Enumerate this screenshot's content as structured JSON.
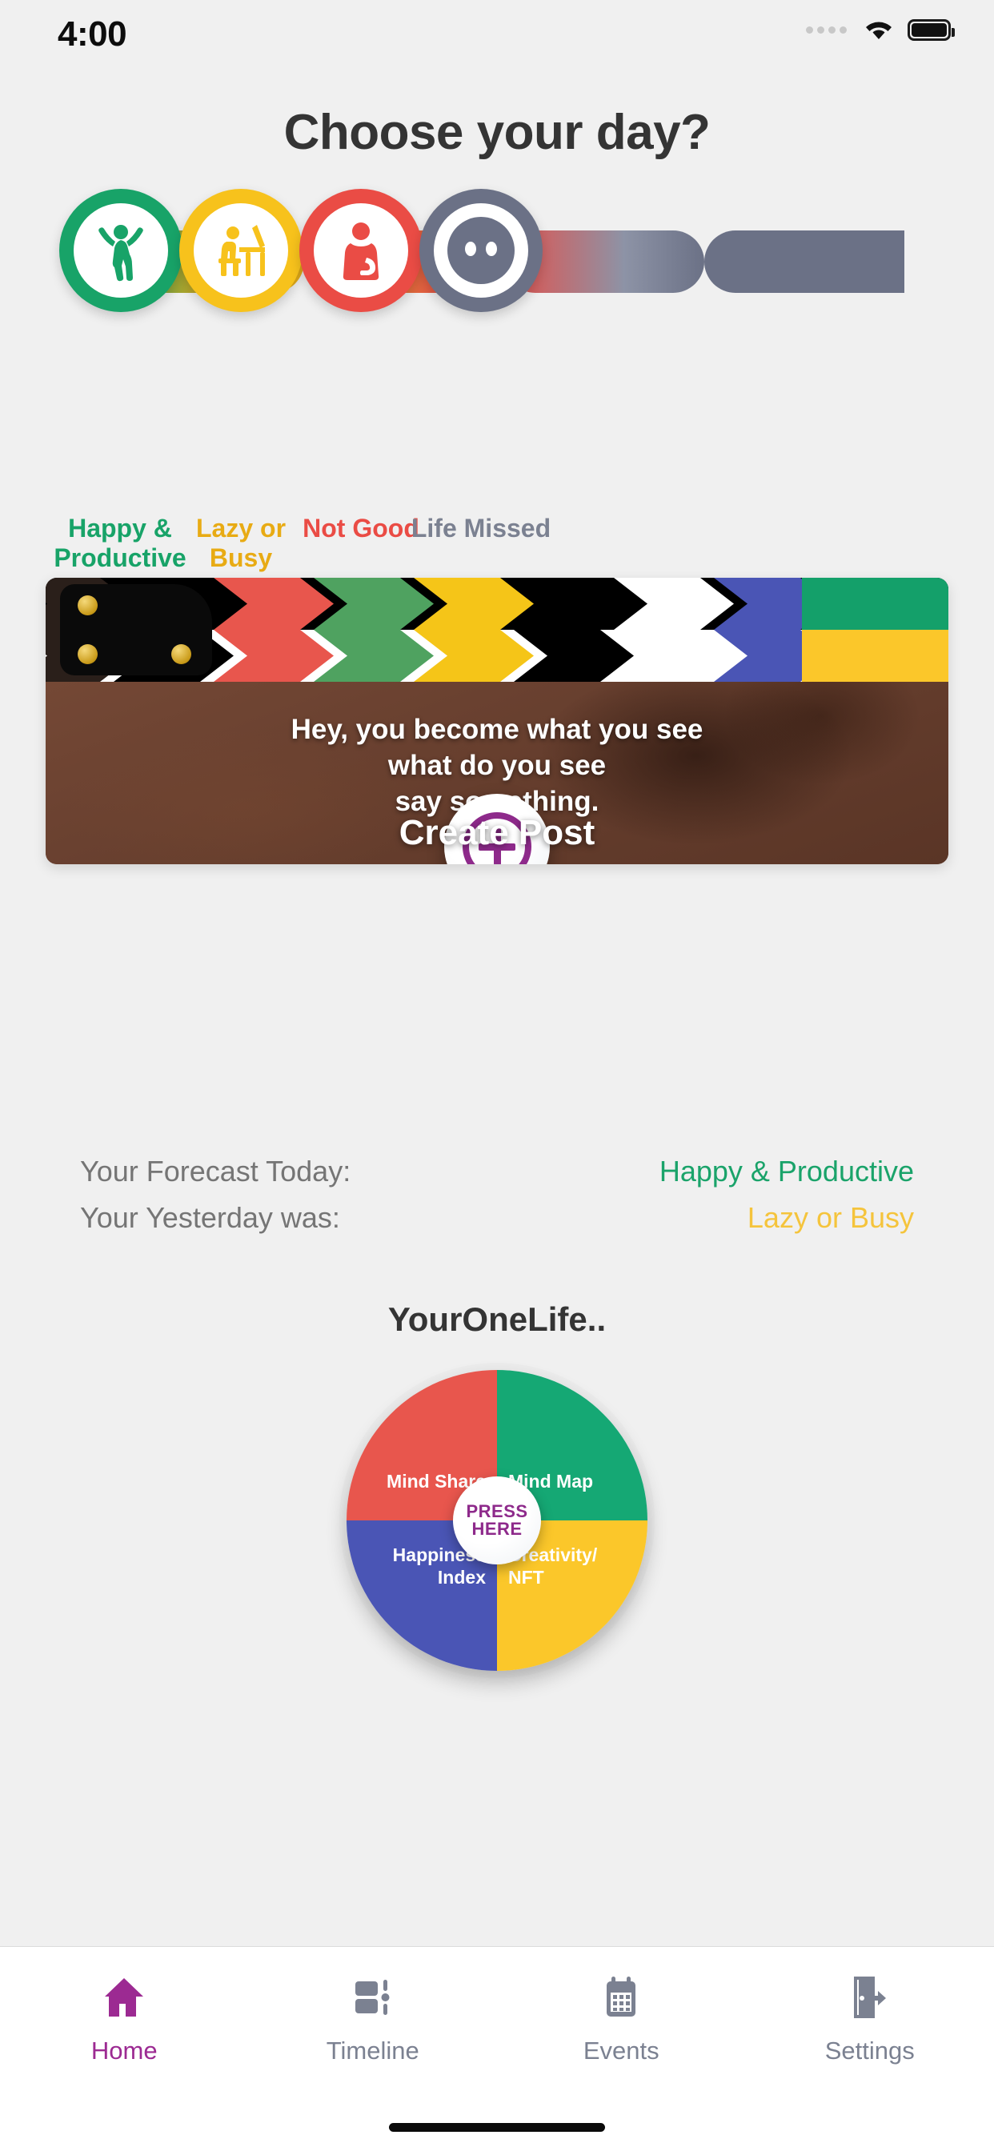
{
  "status_bar": {
    "time": "4:00",
    "wifi_icon": "wifi-icon",
    "battery_icon": "battery-icon",
    "signal_dots_icon": "signal-dots-icon"
  },
  "header": {
    "title": "Choose your day?"
  },
  "mood_selector": {
    "options": [
      {
        "label": "Happy &\nProductive",
        "color": "#18a368",
        "icon": "jumping-person-icon"
      },
      {
        "label": "Lazy or\nBusy",
        "color": "#f7c21c",
        "icon": "person-at-desk-icon"
      },
      {
        "label": "Not Good",
        "color": "#ea4c45",
        "icon": "sad-person-icon"
      },
      {
        "label": "Life Missed",
        "color": "#6b7186",
        "icon": "blank-face-icon"
      }
    ]
  },
  "post_card": {
    "prompt_line1": "Hey, you become what you see",
    "prompt_line2": "what do you see",
    "prompt_line3": "say something.",
    "create_label": "Create Post",
    "plus_icon": "plus-circle-icon",
    "clapper_icon": "clapper-board-icon",
    "clapper_colors": [
      "#2a1f1a",
      "#000000",
      "#e8564d",
      "#4fa260",
      "#f5c518",
      "#000000",
      "#ffffff",
      "#4a55b5",
      "#14a06a"
    ],
    "accent": "#8e2a8b"
  },
  "forecast": {
    "today_key": "Your Forecast Today:",
    "today_value": "Happy & Productive",
    "today_color": "#1aa36a",
    "yesterday_key": "Your Yesterday was:",
    "yesterday_value": "Lazy or Busy",
    "yesterday_color": "#f5c43c"
  },
  "wheel": {
    "title": "YourOneLife..",
    "center_line1": "PRESS",
    "center_line2": "HERE",
    "center_color": "#8e2a8b",
    "quadrants": [
      {
        "label": "Mind Share",
        "color": "#e8564d",
        "position": "top-left"
      },
      {
        "label": "Mind Map",
        "color": "#15a874",
        "position": "top-right"
      },
      {
        "label": "Happiness\nIndex",
        "color": "#4a55b5",
        "position": "bottom-left"
      },
      {
        "label": "Creativity/\nNFT",
        "color": "#fbc72a",
        "position": "bottom-right"
      }
    ]
  },
  "tabbar": {
    "active_color": "#9c2a92",
    "inactive_color": "#7b8191",
    "items": [
      {
        "label": "Home",
        "icon": "home-icon",
        "active": true
      },
      {
        "label": "Timeline",
        "icon": "timeline-icon",
        "active": false
      },
      {
        "label": "Events",
        "icon": "calendar-icon",
        "active": false
      },
      {
        "label": "Settings",
        "icon": "exit-door-icon",
        "active": false
      }
    ]
  }
}
